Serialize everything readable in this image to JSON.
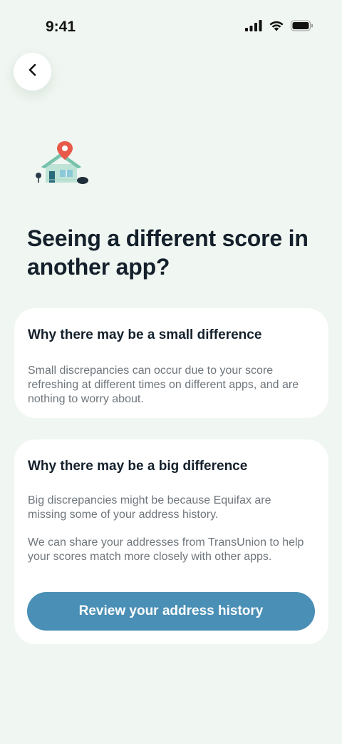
{
  "status_bar": {
    "time": "9:41",
    "icons": [
      "cellular-signal-icon",
      "wifi-icon",
      "battery-icon"
    ]
  },
  "nav": {
    "back_icon": "chevron-left-icon"
  },
  "illustration": {
    "icon": "house-location-pin-icon"
  },
  "title": "Seeing a different score in another app?",
  "cards": {
    "small": {
      "title": "Why there may be a small difference",
      "text": "Small discrepancies can occur due to your score refreshing at different times on different apps, and are nothing to worry about."
    },
    "big": {
      "title": "Why there may be a big difference",
      "text_1": "Big discrepancies might be because Equifax are missing some of your address history.",
      "text_2": "We can share your addresses from TransUnion to help your scores match more closely with other apps.",
      "button_label": "Review your address history"
    }
  },
  "colors": {
    "background": "#f0f6f1",
    "card": "#ffffff",
    "primary_button": "#4a8fb5",
    "title_text": "#14202b",
    "body_text": "#6f767c",
    "pin": "#e8594a",
    "house": "#7dc4b0"
  }
}
